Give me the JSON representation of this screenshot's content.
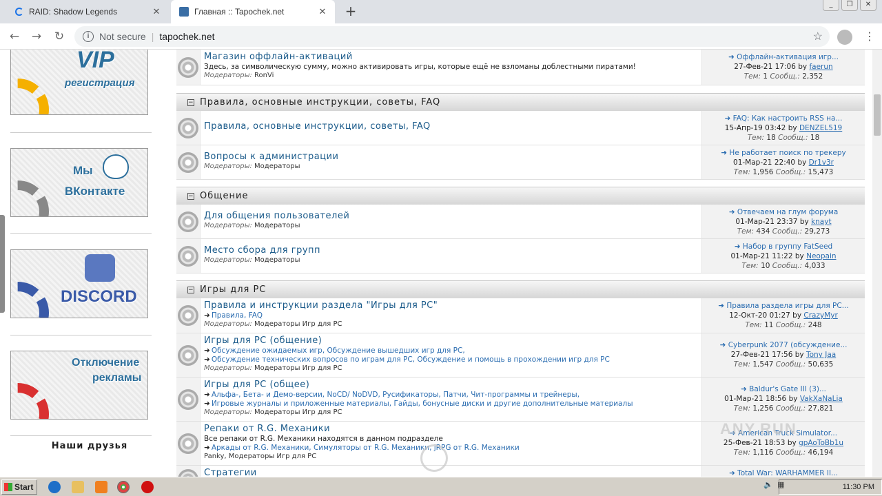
{
  "browser": {
    "tabs": [
      {
        "title": "RAID: Shadow Legends"
      },
      {
        "title": "Главная :: Tapochek.net"
      }
    ],
    "new_tab": "+",
    "not_secure": "Not secure",
    "url": "tapochek.net"
  },
  "sidebar": {
    "banners": [
      {
        "text": "VIP регистрация",
        "line1": "VIP",
        "line2": "регистрация",
        "color": "#f5b000"
      },
      {
        "text": "Мы ВКонтакте",
        "line1": "Мы",
        "line2": "ВКонтакте",
        "color": "#888888"
      },
      {
        "text": "DISCORD",
        "line1": "",
        "line2": "DISCORD",
        "color": "#3a5aa8"
      },
      {
        "text": "Отключение рекламы",
        "line1": "Отключение",
        "line2": "рекламы",
        "color": "#d93030"
      }
    ],
    "friends_label": "Наши друзья"
  },
  "forum": {
    "rows_top": [
      {
        "title": "Магазин оффлайн-активаций",
        "desc": "Здесь, за символическую сумму, можно активировать игры, которые ещё не взломаны доблестными пиратами!",
        "mods_label": "Модераторы:",
        "mods": "RonVi",
        "last_title": "Оффлайн-активация игр...",
        "last_date": "27-Фев-21 17:06",
        "last_by": "faerun",
        "topics": "1",
        "posts": "2,352"
      }
    ],
    "categories": [
      {
        "name": "Правила, основные инструкции, советы, FAQ"
      },
      {
        "name": "Общение"
      },
      {
        "name": "Игры для PC"
      }
    ],
    "rows_rules": [
      {
        "title": "Правила, основные инструкции, советы, FAQ",
        "last_title": "FAQ: Как настроить RSS на...",
        "last_date": "15-Апр-19 03:42",
        "last_by": "DENZEL519",
        "topics": "18",
        "posts": "18"
      },
      {
        "title": "Вопросы к администрации",
        "mods_label": "Модераторы:",
        "mods": "Модераторы",
        "last_title": "Не работает поиск по трекеру",
        "last_date": "01-Мар-21 22:40",
        "last_by": "Dr1v3r",
        "topics": "1,956",
        "posts": "15,473"
      }
    ],
    "rows_social": [
      {
        "title": "Для общения пользователей",
        "mods_label": "Модераторы:",
        "mods": "Модераторы",
        "last_title": "Отвечаем на глум форума",
        "last_date": "01-Мар-21 23:37",
        "last_by": "knayt",
        "topics": "434",
        "posts": "29,273"
      },
      {
        "title": "Место сбора для групп",
        "mods_label": "Модераторы:",
        "mods": "Модераторы",
        "last_title": "Набор в группу FatSeed",
        "last_date": "01-Мар-21 11:22",
        "last_by": "Neopain",
        "topics": "10",
        "posts": "4,033"
      }
    ],
    "rows_pc": [
      {
        "title": "Правила и инструкции раздела \"Игры для PC\"",
        "subs1": "Правила, FAQ",
        "mods_label": "Модераторы:",
        "mods": "Модераторы Игр для PC",
        "last_title": "Правила раздела игры для PC...",
        "last_date": "12-Окт-20 01:27",
        "last_by": "CrazyMyr",
        "topics": "11",
        "posts": "248"
      },
      {
        "title": "Игры для PC (общение)",
        "subs1": "Обсуждение ожидаемых игр, Обсуждение вышедших игр для PC,",
        "subs2": "Обсуждение технических вопросов по играм для PC, Обсуждение и помощь в прохождении игр для PC",
        "mods_label": "Модераторы:",
        "mods": "Модераторы Игр для PC",
        "last_title": "Cyberpunk 2077 (обсуждение...",
        "last_date": "27-Фев-21 17:56",
        "last_by": "Tony Jaa",
        "topics": "1,547",
        "posts": "50,635"
      },
      {
        "title": "Игры для PC (общее)",
        "subs1": "Альфа-, Бета- и Демо-версии, NoCD/ NoDVD, Русификаторы, Патчи, Чит-программы и трейнеры,",
        "subs2": "Игровые журналы и приложенные материалы, Гайды, бонусные диски и другие дополнительные материалы",
        "mods_label": "Модераторы:",
        "mods": "Модераторы Игр для PC",
        "last_title": "Baldur's Gate III (3)...",
        "last_date": "01-Мар-21 18:56",
        "last_by": "VakXaNaLia",
        "topics": "1,256",
        "posts": "27,821"
      },
      {
        "title": "Репаки от R.G. Механики",
        "desc": "Все репаки от R.G. Механики находятся в данном подразделе",
        "subs1": "Аркады от R.G. Механики, Симуляторы от R.G. Механики, jRPG от R.G. Механики",
        "mods_label": "",
        "mods": "Panky, Модераторы Игр для PC",
        "last_title": "American Truck Simulator...",
        "last_date": "25-Фев-21 18:53",
        "last_by": "gpAoToBb1u",
        "topics": "1,116",
        "posts": "46,194"
      },
      {
        "title": "Стратегии",
        "last_title": "Total War: WARHAMMER II..."
      }
    ],
    "labels": {
      "topics": "Тем:",
      "posts": "Сообщ.:",
      "by": "by"
    }
  },
  "taskbar": {
    "start": "Start",
    "clock": "11:30 PM"
  },
  "watermark": "ANY.RUN"
}
